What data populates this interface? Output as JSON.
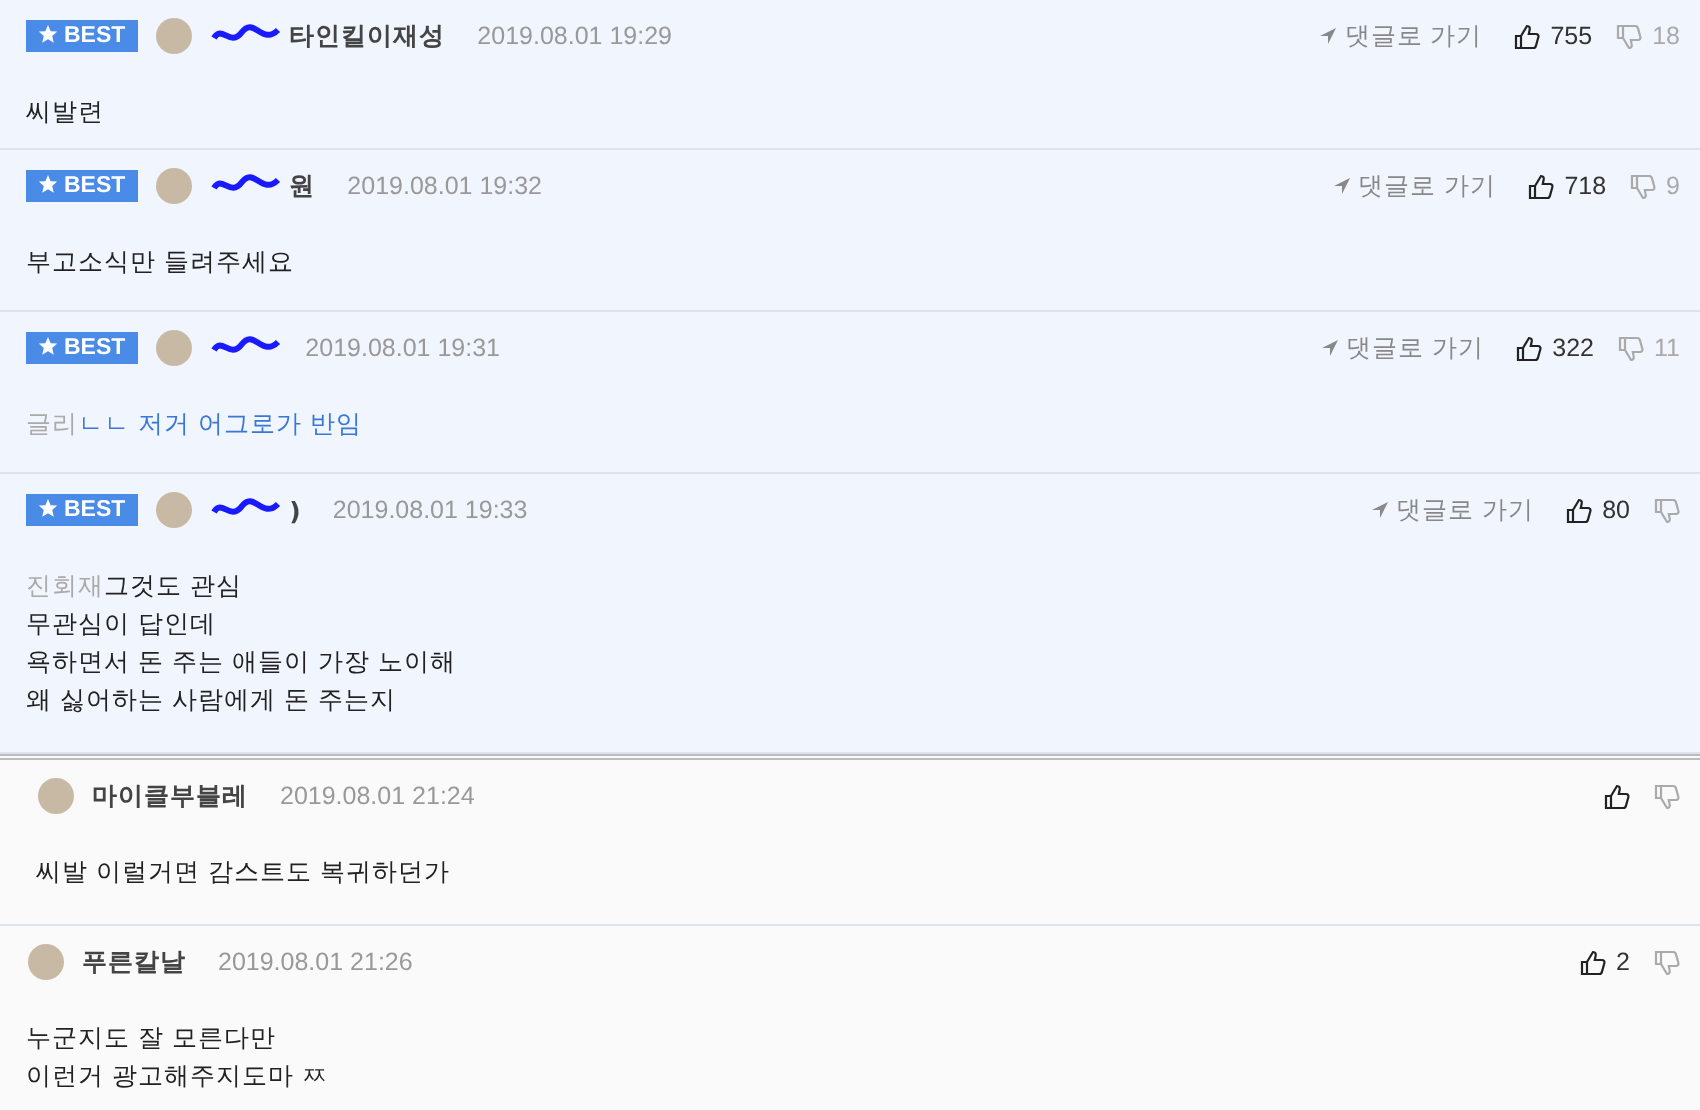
{
  "comments": [
    {
      "best": true,
      "badge": "BEST",
      "author": "타인킬이재성",
      "scribbled": true,
      "time": "2019.08.01 19:29",
      "goto": "댓글로 가기",
      "likes": "755",
      "dislikes": "18",
      "lines": [
        "씨발련"
      ]
    },
    {
      "best": true,
      "badge": "BEST",
      "author": "원",
      "scribbled": true,
      "time": "2019.08.01 19:32",
      "goto": "댓글로 가기",
      "likes": "718",
      "dislikes": "9",
      "lines": [
        "부고소식만 들려주세요"
      ]
    },
    {
      "best": true,
      "badge": "BEST",
      "scribbled": true,
      "time": "2019.08.01 19:31",
      "goto": "댓글로 가기",
      "likes": "322",
      "dislikes": "11",
      "mention": "글리",
      "link": true,
      "lines": [
        "ㄴㄴ 저거 어그로가 반임"
      ]
    },
    {
      "best": true,
      "badge": "BEST",
      "author": ")",
      "scribbled": true,
      "time": "2019.08.01 19:33",
      "goto": "댓글로 가기",
      "likes": "80",
      "mention": "진회재",
      "link": false,
      "lines": [
        "그것도 관심",
        "무관심이 답인데",
        "욕하면서 돈 주는 애들이 가장 노이해",
        "왜 싫어하는 사람에게 돈 주는지"
      ]
    },
    {
      "best": false,
      "author": "마이클부블레",
      "scribbled": false,
      "time": "2019.08.01 21:24",
      "lines": [
        "씨발 이럴거면 감스트도 복귀하던가"
      ]
    },
    {
      "best": false,
      "author": "푸른칼날",
      "scribbled": false,
      "time": "2019.08.01 21:26",
      "likes": "2",
      "lines": [
        "누군지도 잘 모른다만",
        "이런거 광고해주지도마 ㅉ"
      ]
    }
  ]
}
